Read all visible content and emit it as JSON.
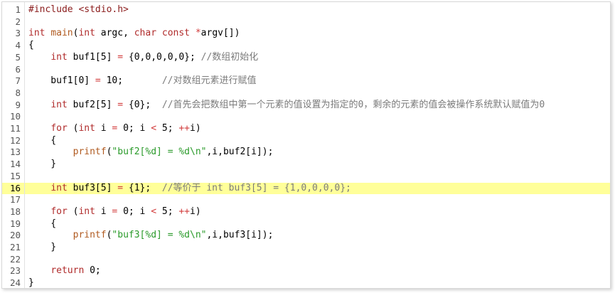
{
  "editor": {
    "current_line": 16,
    "colors": {
      "keyword": "#b02b2b",
      "string": "#2a9a2a",
      "comment": "#7b7b7b",
      "current_line_bg": "#ffff99"
    },
    "lines": [
      {
        "n": "1",
        "tokens": [
          {
            "c": "pp",
            "t": "#include <stdio.h>"
          }
        ]
      },
      {
        "n": "2",
        "tokens": []
      },
      {
        "n": "3",
        "tokens": [
          {
            "c": "kw",
            "t": "int"
          },
          {
            "c": "plain",
            "t": " "
          },
          {
            "c": "fn",
            "t": "main"
          },
          {
            "c": "plain",
            "t": "("
          },
          {
            "c": "kw",
            "t": "int"
          },
          {
            "c": "plain",
            "t": " argc, "
          },
          {
            "c": "kw",
            "t": "char"
          },
          {
            "c": "plain",
            "t": " "
          },
          {
            "c": "kw",
            "t": "const"
          },
          {
            "c": "plain",
            "t": " "
          },
          {
            "c": "op",
            "t": "*"
          },
          {
            "c": "plain",
            "t": "argv[])"
          }
        ]
      },
      {
        "n": "4",
        "tokens": [
          {
            "c": "plain",
            "t": "{"
          }
        ]
      },
      {
        "n": "5",
        "tokens": [
          {
            "c": "plain",
            "t": "    "
          },
          {
            "c": "kw",
            "t": "int"
          },
          {
            "c": "plain",
            "t": " buf1[5] "
          },
          {
            "c": "op",
            "t": "="
          },
          {
            "c": "plain",
            "t": " {0,0,0,0,0}; "
          },
          {
            "c": "cm",
            "t": "//数组初始化"
          }
        ]
      },
      {
        "n": "6",
        "tokens": []
      },
      {
        "n": "7",
        "tokens": [
          {
            "c": "plain",
            "t": "    buf1[0] "
          },
          {
            "c": "op",
            "t": "="
          },
          {
            "c": "plain",
            "t": " 10;       "
          },
          {
            "c": "cm",
            "t": "//对数组元素进行赋值"
          }
        ]
      },
      {
        "n": "8",
        "tokens": []
      },
      {
        "n": "9",
        "tokens": [
          {
            "c": "plain",
            "t": "    "
          },
          {
            "c": "kw",
            "t": "int"
          },
          {
            "c": "plain",
            "t": " buf2[5] "
          },
          {
            "c": "op",
            "t": "="
          },
          {
            "c": "plain",
            "t": " {0};  "
          },
          {
            "c": "cm",
            "t": "//首先会把数组中第一个元素的值设置为指定的0，剩余的元素的值会被操作系统默认赋值为0"
          }
        ]
      },
      {
        "n": "10",
        "tokens": []
      },
      {
        "n": "11",
        "tokens": [
          {
            "c": "plain",
            "t": "    "
          },
          {
            "c": "kw",
            "t": "for"
          },
          {
            "c": "plain",
            "t": " ("
          },
          {
            "c": "kw",
            "t": "int"
          },
          {
            "c": "plain",
            "t": " i "
          },
          {
            "c": "op",
            "t": "="
          },
          {
            "c": "plain",
            "t": " 0; i "
          },
          {
            "c": "op",
            "t": "<"
          },
          {
            "c": "plain",
            "t": " 5; "
          },
          {
            "c": "op",
            "t": "++"
          },
          {
            "c": "plain",
            "t": "i)"
          }
        ]
      },
      {
        "n": "12",
        "tokens": [
          {
            "c": "plain",
            "t": "    {"
          }
        ]
      },
      {
        "n": "13",
        "tokens": [
          {
            "c": "plain",
            "t": "        "
          },
          {
            "c": "fn",
            "t": "printf"
          },
          {
            "c": "plain",
            "t": "("
          },
          {
            "c": "str",
            "t": "\"buf2[%d] = %d\\n\""
          },
          {
            "c": "plain",
            "t": ",i,buf2[i]);"
          }
        ]
      },
      {
        "n": "14",
        "tokens": [
          {
            "c": "plain",
            "t": "    }"
          }
        ]
      },
      {
        "n": "15",
        "tokens": []
      },
      {
        "n": "16",
        "tokens": [
          {
            "c": "plain",
            "t": "    "
          },
          {
            "c": "kw",
            "t": "int"
          },
          {
            "c": "plain",
            "t": " buf3[5] "
          },
          {
            "c": "op",
            "t": "="
          },
          {
            "c": "plain",
            "t": " {1};  "
          },
          {
            "c": "cm",
            "t": "//等价于 int buf3[5] = {1,0,0,0,0};"
          }
        ]
      },
      {
        "n": "17",
        "tokens": []
      },
      {
        "n": "18",
        "tokens": [
          {
            "c": "plain",
            "t": "    "
          },
          {
            "c": "kw",
            "t": "for"
          },
          {
            "c": "plain",
            "t": " ("
          },
          {
            "c": "kw",
            "t": "int"
          },
          {
            "c": "plain",
            "t": " i "
          },
          {
            "c": "op",
            "t": "="
          },
          {
            "c": "plain",
            "t": " 0; i "
          },
          {
            "c": "op",
            "t": "<"
          },
          {
            "c": "plain",
            "t": " 5; "
          },
          {
            "c": "op",
            "t": "++"
          },
          {
            "c": "plain",
            "t": "i)"
          }
        ]
      },
      {
        "n": "19",
        "tokens": [
          {
            "c": "plain",
            "t": "    {"
          }
        ]
      },
      {
        "n": "20",
        "tokens": [
          {
            "c": "plain",
            "t": "        "
          },
          {
            "c": "fn",
            "t": "printf"
          },
          {
            "c": "plain",
            "t": "("
          },
          {
            "c": "str",
            "t": "\"buf3[%d] = %d\\n\""
          },
          {
            "c": "plain",
            "t": ",i,buf3[i]);"
          }
        ]
      },
      {
        "n": "21",
        "tokens": [
          {
            "c": "plain",
            "t": "    }"
          }
        ]
      },
      {
        "n": "22",
        "tokens": []
      },
      {
        "n": "23",
        "tokens": [
          {
            "c": "plain",
            "t": "    "
          },
          {
            "c": "kw",
            "t": "return"
          },
          {
            "c": "plain",
            "t": " 0;"
          }
        ]
      },
      {
        "n": "24",
        "tokens": [
          {
            "c": "plain",
            "t": "}"
          }
        ]
      }
    ]
  }
}
